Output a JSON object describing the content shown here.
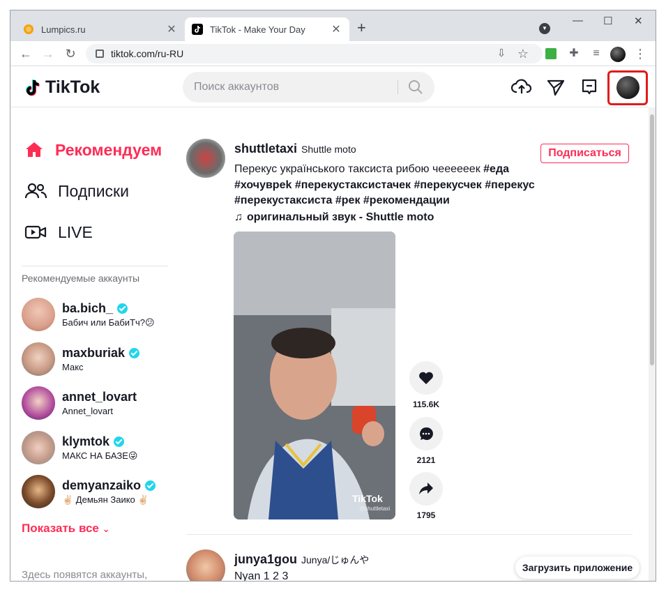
{
  "browser": {
    "tabs": [
      {
        "title": "Lumpics.ru",
        "close": "✕"
      },
      {
        "title": "TikTok - Make Your Day",
        "close": "✕"
      }
    ],
    "new_tab": "+",
    "window_controls": {
      "minimize": "—",
      "maximize": "☐",
      "close": "✕"
    },
    "url": "tiktok.com/ru-RU"
  },
  "tiktok": {
    "logo_text": "TikTok",
    "search_placeholder": "Поиск аккаунтов",
    "nav": [
      {
        "label": "Рекомендуем",
        "icon": "home-icon",
        "active": true
      },
      {
        "label": "Подписки",
        "icon": "users-icon",
        "active": false
      },
      {
        "label": "LIVE",
        "icon": "live-icon",
        "active": false
      }
    ],
    "suggested_caption": "Рекомендуемые аккаунты",
    "accounts": [
      {
        "handle": "ba.bich_",
        "name": "Бабич или БабиТч?😕",
        "verified": true
      },
      {
        "handle": "maxburiak",
        "name": "Макс",
        "verified": true
      },
      {
        "handle": "annet_lovart",
        "name": "Annet_lovart",
        "verified": false
      },
      {
        "handle": "klymtok",
        "name": "МАКС НА БАЗЕ😜",
        "verified": true
      },
      {
        "handle": "demyanzaiko",
        "name": "✌🏻 Демьян Заико ✌🏻",
        "verified": true
      }
    ],
    "show_all": "Показать все",
    "footer_text": "Здесь появятся аккаунты,",
    "download_app": "Загрузить приложение",
    "post": {
      "username": "shuttletaxi",
      "display_name": "Shuttle moto",
      "follow_label": "Подписаться",
      "caption_line1": "Перекус українського таксиста рибою чеееееек ",
      "tag_food": "#еда",
      "tags_line2": "#хочувреk #перекустаксистачек #перекусчек #перекус",
      "tags_line3": "#перекустаксиста #рек #рекомендации",
      "music": "оригинальный звук - Shuttle moto",
      "likes": "115.6K",
      "comments": "2121",
      "shares": "1795",
      "watermark": "TikTok",
      "watermark_user": "@shuttletaxi"
    },
    "post2": {
      "username": "junya1gou",
      "display_name": "Junya/じゅんや",
      "caption": "Nyan 1 2 3"
    }
  },
  "colors": {
    "accent": "#fe2c55",
    "highlight_border": "#e01b1b",
    "verified": "#20d5ec"
  }
}
